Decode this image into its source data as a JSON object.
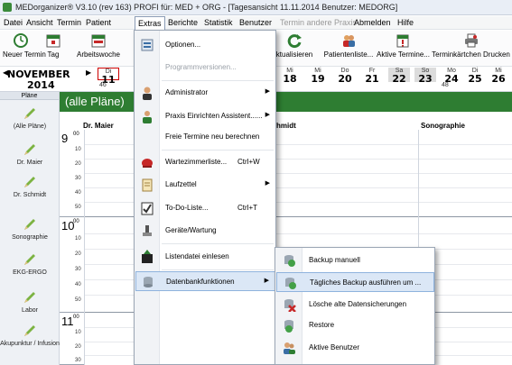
{
  "window": {
    "title": "MEDorganizer® V3.10 (rev 163) PROFI für: MED + ORG - [Tagesansicht 11.11.2014   Benutzer: MEDORG]"
  },
  "menubar": [
    "Datei",
    "Ansicht",
    "Termin",
    "Patient",
    "Extras",
    "Berichte",
    "Statistik",
    "Benutzer",
    "Termin andere Praxis",
    "Abmelden",
    "Hilfe"
  ],
  "toolbar": {
    "neuer_termin": "Neuer Termin",
    "tag": "Tag",
    "arbeitswoche": "Arbeitswoche",
    "aktualisieren": "ktualisieren",
    "patientenliste": "Patientenliste...",
    "aktive_termine": "Aktive Termine...",
    "terminkaertchen": "Terminkärtchen Drucken"
  },
  "datebar": {
    "month": "NOVEMBER",
    "year": "2014",
    "week_left": "46",
    "week_right": "48",
    "days": [
      {
        "name": "Di",
        "num": "11"
      },
      {
        "name": "Mi",
        "num": "18"
      },
      {
        "name": "Mi",
        "num": "19"
      },
      {
        "name": "Do",
        "num": "20"
      },
      {
        "name": "Fr",
        "num": "21"
      },
      {
        "name": "Sa",
        "num": "22"
      },
      {
        "name": "So",
        "num": "23"
      },
      {
        "name": "Mo",
        "num": "24"
      },
      {
        "name": "Di",
        "num": "25"
      },
      {
        "name": "Mi",
        "num": "26"
      }
    ]
  },
  "sidebar": {
    "header": "Pläne",
    "items": [
      "(Alle Pläne)",
      "Dr. Maier",
      "Dr. Schmidt",
      "Sonographie",
      "EKG-ERGO",
      "Labor",
      "Akupunktur / Infusion"
    ]
  },
  "calendar": {
    "header": "(alle Pläne)",
    "columns": [
      "Dr. Maier",
      "hmidt",
      "Sonographie"
    ],
    "hours": [
      "9",
      "10",
      "11"
    ],
    "hour_sup": "00",
    "minutes": [
      "10",
      "20",
      "30",
      "40",
      "50"
    ]
  },
  "extras_menu": {
    "items": [
      {
        "label": "Optionen...",
        "shortcut": "",
        "submenu": false,
        "disabled": false
      },
      {
        "label": "Programmversionen...",
        "shortcut": "",
        "submenu": false,
        "disabled": true
      },
      {
        "label": "Administrator",
        "shortcut": "",
        "submenu": true,
        "disabled": false
      },
      {
        "label": "Praxis Einrichten Assistent......",
        "shortcut": "",
        "submenu": true,
        "disabled": false
      },
      {
        "label": "Freie Termine neu berechnen",
        "shortcut": "",
        "submenu": false,
        "disabled": false
      },
      {
        "label": "Wartezimmerliste...",
        "shortcut": "Ctrl+W",
        "submenu": false,
        "disabled": false
      },
      {
        "label": "Laufzettel",
        "shortcut": "",
        "submenu": true,
        "disabled": false
      },
      {
        "label": "To-Do-Liste...",
        "shortcut": "Ctrl+T",
        "submenu": false,
        "disabled": false
      },
      {
        "label": "Geräte/Wartung",
        "shortcut": "",
        "submenu": false,
        "disabled": false
      },
      {
        "label": "Listendatei einlesen",
        "shortcut": "",
        "submenu": false,
        "disabled": false
      },
      {
        "label": "Datenbankfunktionen",
        "shortcut": "",
        "submenu": true,
        "disabled": false
      }
    ]
  },
  "db_submenu": {
    "items": [
      "Backup manuell",
      "Tägliches Backup ausführen um ...",
      "Lösche alte Datensicherungen",
      "Restore",
      "Aktive Benutzer"
    ]
  },
  "colors": {
    "calendar_header": "#2e7d32",
    "highlight": "#dbe7f6",
    "highlight_border": "#8fb3dd"
  }
}
